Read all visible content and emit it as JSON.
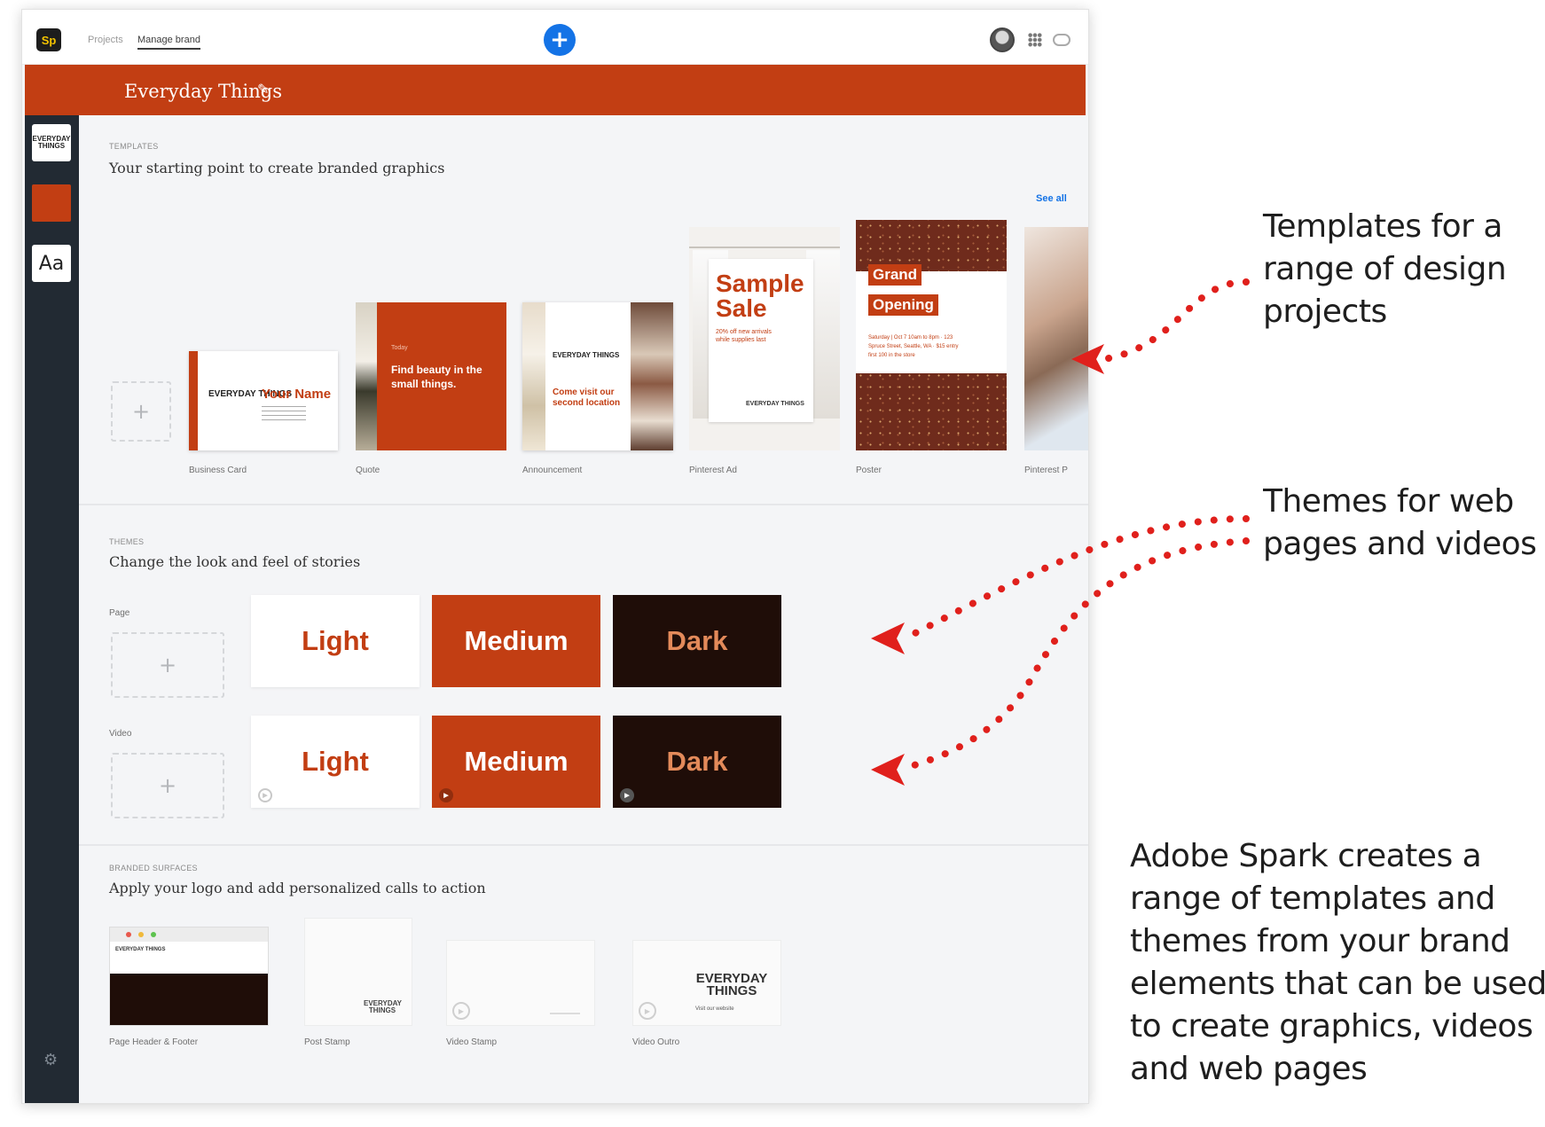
{
  "app": {
    "logo": "Sp",
    "breadcrumbs": [
      "Projects",
      "Manage brand"
    ],
    "add_icon": "plus-icon",
    "brand_name": "Everyday Things",
    "brand_color": "#c23e13",
    "accent_blue": "#1473e6",
    "sidebar": {
      "font_swatch": "Aa",
      "logo_text": "EVERYDAY THINGS"
    }
  },
  "templates": {
    "section_label": "TEMPLATES",
    "title": "Your starting point to create branded graphics",
    "see_all": "See all",
    "items": [
      {
        "label": "Business Card",
        "logo": "EVERYDAY THINGS",
        "headline": "Your Name"
      },
      {
        "label": "Quote",
        "small": "Today",
        "headline": "Find beauty in the small things."
      },
      {
        "label": "Announcement",
        "logo": "EVERYDAY THINGS",
        "headline": "Come visit our second location"
      },
      {
        "label": "Pinterest Ad",
        "headline": "Sample Sale",
        "sub": "20% off new arrivals while supplies last",
        "logo": "EVERYDAY THINGS"
      },
      {
        "label": "Poster",
        "headline1": "Grand",
        "headline2": "Opening",
        "info": "Saturday | Oct 7 10am to 8pm · 123 Spruce Street, Seattle, WA · $15 entry first 100 in the store"
      },
      {
        "label": "Pinterest P"
      }
    ]
  },
  "themes": {
    "section_label": "THEMES",
    "title": "Change the look and feel of stories",
    "rows": [
      {
        "label": "Page",
        "items": [
          "Light",
          "Medium",
          "Dark"
        ]
      },
      {
        "label": "Video",
        "items": [
          "Light",
          "Medium",
          "Dark"
        ]
      }
    ]
  },
  "surfaces": {
    "section_label": "BRANDED SURFACES",
    "title": "Apply your logo and add personalized calls to action",
    "items": [
      {
        "label": "Page Header & Footer"
      },
      {
        "label": "Post Stamp",
        "logo": "EVERYDAY THINGS"
      },
      {
        "label": "Video Stamp"
      },
      {
        "label": "Video Outro",
        "logo": "EVERYDAY THINGS",
        "sub": "Visit our website"
      }
    ]
  },
  "annotations": {
    "templates": [
      "Templates for a",
      "range of design",
      "projects"
    ],
    "themes": [
      "Themes for web",
      "pages and videos"
    ],
    "summary": [
      "Adobe Spark creates a",
      "range of templates and",
      "themes from your brand",
      "elements that can be used",
      "to create graphics, videos",
      "and web pages"
    ],
    "arrow_color": "#e0201c"
  }
}
